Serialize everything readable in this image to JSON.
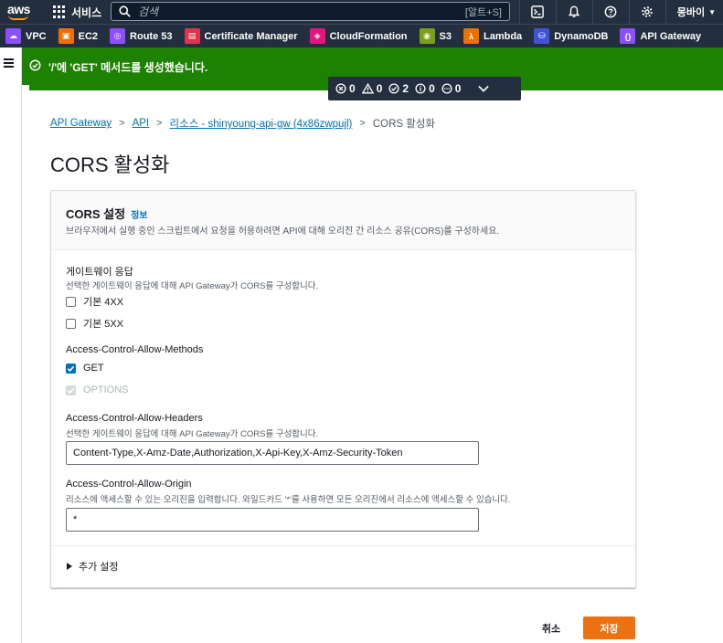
{
  "topnav": {
    "logo_text": "aws",
    "services_label": "서비스",
    "search_placeholder": "검색",
    "search_shortcut": "[알트+S]",
    "user_label": "몽바이"
  },
  "favorites": [
    {
      "label": "VPC",
      "icon": "vpc-icon",
      "color": "#8c4fff"
    },
    {
      "label": "EC2",
      "icon": "ec2-icon",
      "color": "#ed7100"
    },
    {
      "label": "Route 53",
      "icon": "route53-icon",
      "color": "#8c4fff"
    },
    {
      "label": "Certificate Manager",
      "icon": "certificate-manager-icon",
      "color": "#dd344c"
    },
    {
      "label": "CloudFormation",
      "icon": "cloudformation-icon",
      "color": "#e7157b"
    },
    {
      "label": "S3",
      "icon": "s3-icon",
      "color": "#7aa116"
    },
    {
      "label": "Lambda",
      "icon": "lambda-icon",
      "color": "#ed7100"
    },
    {
      "label": "DynamoDB",
      "icon": "dynamodb-icon",
      "color": "#4053d6"
    },
    {
      "label": "API Gateway",
      "icon": "api-gateway-icon",
      "color": "#8c4fff"
    }
  ],
  "flash": {
    "message": "'/'에 'GET' 메서드를 생성했습니다.",
    "color": "#1d8102"
  },
  "notifications": {
    "errors": "0",
    "warnings": "0",
    "success": "2",
    "info": "0",
    "in_progress": "0"
  },
  "breadcrumb": {
    "items": [
      "API Gateway",
      "API",
      "리소스 - shinyoung-api-gw (4x86zwpujl)"
    ],
    "current": "CORS 활성화"
  },
  "page_title": "CORS 활성화",
  "cors": {
    "title": "CORS 설정",
    "info": "정보",
    "description": "브라우저에서 실행 중인 스크립트에서 요청을 허용하려면 API에 대해 오리진 간 리소스 공유(CORS)를 구성하세요.",
    "gateway_responses": {
      "label": "게이트웨이 응답",
      "description": "선택한 게이트웨이 응답에 대해 API Gateway가 CORS를 구성합니다.",
      "options": [
        {
          "label": "기본 4XX",
          "checked": false
        },
        {
          "label": "기본 5XX",
          "checked": false
        }
      ]
    },
    "methods": {
      "label": "Access-Control-Allow-Methods",
      "options": [
        {
          "label": "GET",
          "checked": true,
          "disabled": false
        },
        {
          "label": "OPTIONS",
          "checked": true,
          "disabled": true
        }
      ]
    },
    "headers": {
      "label": "Access-Control-Allow-Headers",
      "description": "선택한 게이트웨이 응답에 대해 API Gateway가 CORS를 구성합니다.",
      "value": "Content-Type,X-Amz-Date,Authorization,X-Api-Key,X-Amz-Security-Token"
    },
    "origin": {
      "label": "Access-Control-Allow-Origin",
      "description": "리소스에 액세스할 수 있는 오리진을 입력합니다. 와일드카드 '*'를 사용하면 모든 오리진에서 리소스에 액세스할 수 있습니다.",
      "value": "*"
    },
    "additional_settings": "추가 설정"
  },
  "actions": {
    "cancel": "취소",
    "save": "저장"
  },
  "colors": {
    "accent": "#ec7211",
    "link": "#0073bb",
    "nav_bg": "#232f3e"
  }
}
